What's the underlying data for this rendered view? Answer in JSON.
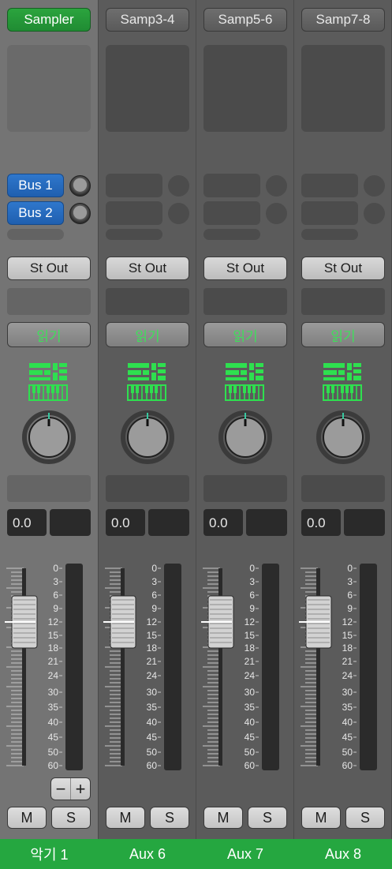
{
  "strips": [
    {
      "name": "Sampler",
      "sends": [
        "Bus 1",
        "Bus 2"
      ],
      "output": "St Out",
      "automation": "읽기",
      "volume": "0.0",
      "mute": "M",
      "solo": "S",
      "footer": "악기 1",
      "selected": true
    },
    {
      "name": "Samp3-4",
      "sends": [],
      "output": "St Out",
      "automation": "읽기",
      "volume": "0.0",
      "mute": "M",
      "solo": "S",
      "footer": "Aux 6",
      "selected": false
    },
    {
      "name": "Samp5-6",
      "sends": [],
      "output": "St Out",
      "automation": "읽기",
      "volume": "0.0",
      "mute": "M",
      "solo": "S",
      "footer": "Aux 7",
      "selected": false
    },
    {
      "name": "Samp7-8",
      "sends": [],
      "output": "St Out",
      "automation": "읽기",
      "volume": "0.0",
      "mute": "M",
      "solo": "S",
      "footer": "Aux 8",
      "selected": false
    }
  ],
  "meter_scale": [
    "0",
    "3",
    "6",
    "9",
    "12",
    "15",
    "18",
    "21",
    "24",
    "30",
    "35",
    "40",
    "45",
    "50",
    "60"
  ],
  "fader_level_db": -12,
  "stepper": {
    "minus": "−",
    "plus": "+"
  },
  "colors": {
    "accent_green": "#25a740",
    "bus_blue": "#2f77cc",
    "auto_green": "#3ee05a",
    "instrument_green": "#2ee04f"
  },
  "icons": {
    "instrument": "keyboard-instrument-icon",
    "pan": "pan-knob-icon"
  }
}
